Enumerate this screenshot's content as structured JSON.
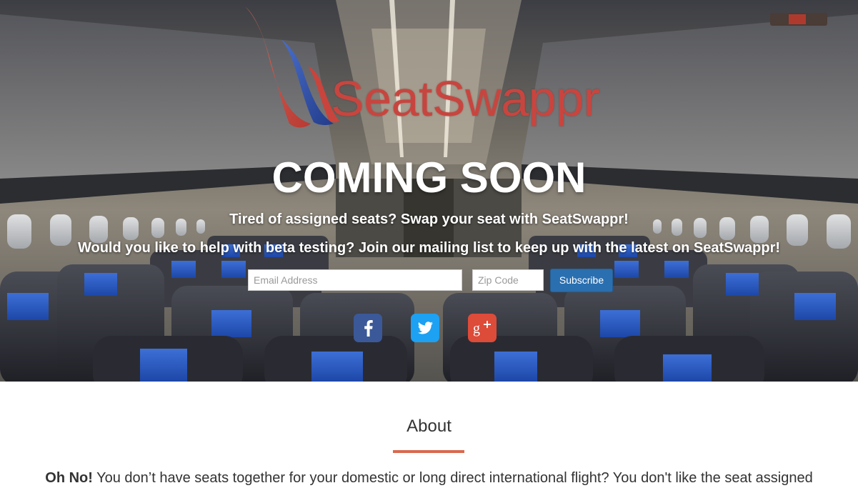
{
  "brand": {
    "name": "SeatSwappr",
    "colors": {
      "logo_red": "#c8453f",
      "logo_blue": "#2c4f9e",
      "accent": "#d9694f"
    }
  },
  "hero": {
    "headline": "COMING SOON",
    "tagline": "Tired of assigned seats? Swap your seat with SeatSwappr!",
    "beta_text": "Would you like to help with beta testing? Join our mailing list to keep up with the latest on SeatSwappr!"
  },
  "signup": {
    "email_placeholder": "Email Address",
    "email_value": "",
    "zip_placeholder": "Zip Code",
    "zip_value": "",
    "subscribe_label": "Subscribe"
  },
  "social": [
    {
      "icon": "facebook-icon",
      "color": "#3b5998"
    },
    {
      "icon": "twitter-icon",
      "color": "#1da1f2"
    },
    {
      "icon": "google-plus-icon",
      "color": "#dd4b39"
    }
  ],
  "about": {
    "title": "About",
    "lead_bold": "Oh No!",
    "text": " You don’t have seats together for your domestic or long direct international flight? You don't like the seat assigned"
  }
}
